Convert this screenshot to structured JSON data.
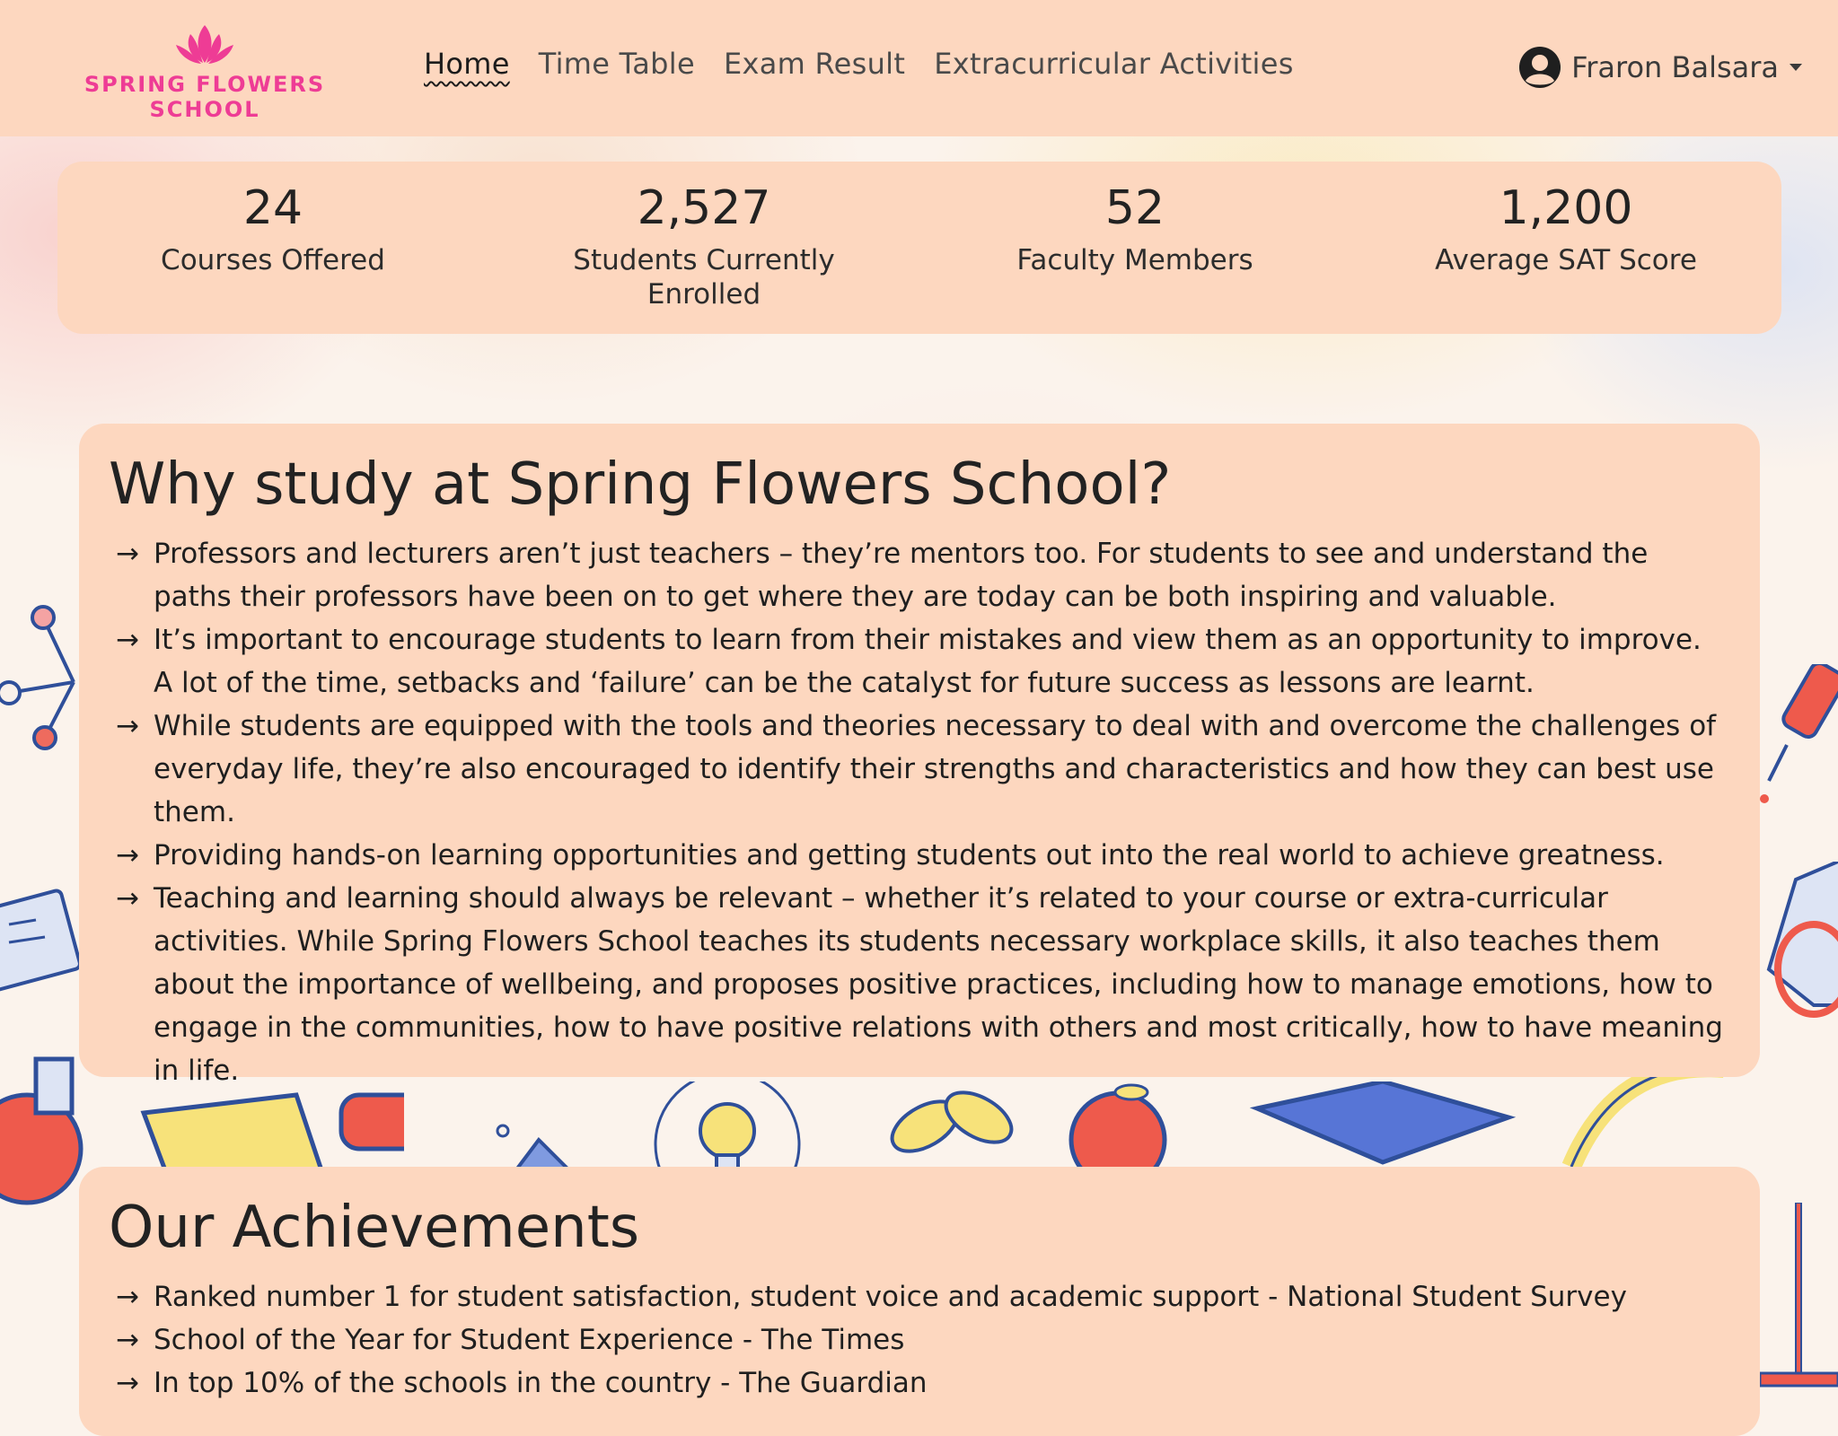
{
  "brand": {
    "name": "SPRING FLOWERS SCHOOL",
    "color": "#ee3c95"
  },
  "nav": {
    "items": [
      {
        "label": "Home",
        "active": true
      },
      {
        "label": "Time Table",
        "active": false
      },
      {
        "label": "Exam Result",
        "active": false
      },
      {
        "label": "Extracurricular Activities",
        "active": false
      }
    ]
  },
  "user": {
    "name": "Fraron Balsara",
    "icon": "user-circle-icon"
  },
  "stats": [
    {
      "value": "24",
      "label": "Courses Offered"
    },
    {
      "value": "2,527",
      "label": "Students Currently Enrolled"
    },
    {
      "value": "52",
      "label": "Faculty Members"
    },
    {
      "value": "1,200",
      "label": "Average SAT Score"
    }
  ],
  "why": {
    "title": "Why study at Spring Flowers School?",
    "arrow": "→",
    "items": [
      "Professors and lecturers aren’t just teachers – they’re mentors too. For students to see and understand the paths their professors have been on to get where they are today can be both inspiring and valuable.",
      "It’s important to encourage students to learn from their mistakes and view them as an opportunity to improve. A lot of the time, setbacks and ‘failure’ can be the catalyst for future success as lessons are learnt.",
      "While students are equipped with the tools and theories necessary to deal with and overcome the challenges of everyday life, they’re also encouraged to identify their strengths and characteristics and how they can best use them.",
      "Providing hands-on learning opportunities and getting students out into the real world to achieve greatness.",
      "Teaching and learning should always be relevant – whether it’s related to your course or extra-curricular activities. While Spring Flowers School teaches its students necessary workplace skills, it also teaches them about the importance of wellbeing, and proposes positive practices, including how to manage emotions, how to engage in the communities, how to have positive relations with others and most critically, how to have meaning in life."
    ]
  },
  "achievements": {
    "title": "Our Achievements",
    "arrow": "→",
    "items": [
      "Ranked number 1 for student satisfaction, student voice and academic support - National Student Survey",
      "School of the Year for Student Experience - The Times",
      "In top 10% of the schools in the country - The Guardian"
    ]
  },
  "colors": {
    "panel": "#fdd7bf",
    "background": "#fbf3ec"
  }
}
